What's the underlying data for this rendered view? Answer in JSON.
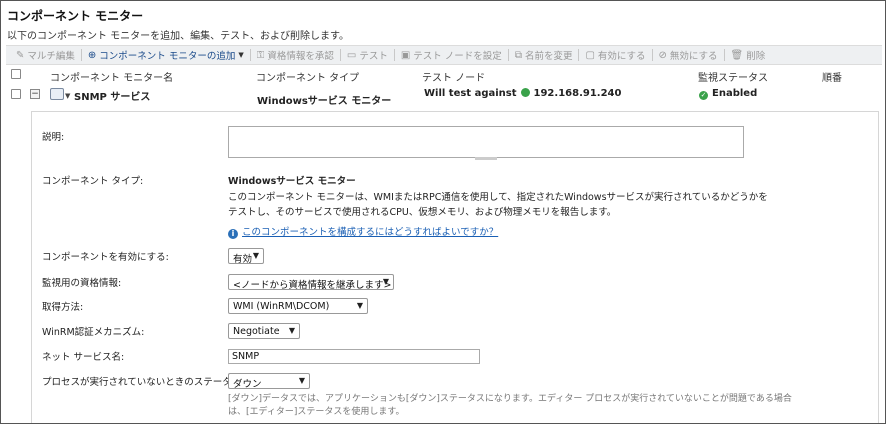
{
  "header": {
    "title": "コンポーネント モニター",
    "subtitle": "以下のコンポーネント モニターを追加、編集、テスト、および削除します。"
  },
  "toolbar": {
    "multi_edit": "マルチ編集",
    "add_monitor": "コンポーネント モニターの追加",
    "approve_credentials": "資格情報を承認",
    "test": "テスト",
    "set_test_node": "テスト ノードを設定",
    "rename": "名前を変更",
    "enable": "有効にする",
    "disable": "無効にする",
    "delete": "削除"
  },
  "columns": {
    "name": "コンポーネント モニター名",
    "type": "コンポーネント タイプ",
    "test_node": "テスト ノード",
    "status": "監視ステータス",
    "order": "順番"
  },
  "monitor_row": {
    "name": "SNMP サービス",
    "type": "Windowsサービス モニター",
    "test_node_prefix": "Will test against",
    "test_node_ip": "192.168.91.240",
    "status": "Enabled"
  },
  "details": {
    "description_label": "説明:",
    "description_value": "",
    "component_type_label": "コンポーネント タイプ:",
    "component_type_value": "Windowsサービス モニター",
    "component_desc_line1": "このコンポーネント モニターは、WMIまたはRPC通信を使用して、指定されたWindowsサービスが実行されているかどうかを",
    "component_desc_line2": "テストし、そのサービスで使用されるCPU、仮想メモリ、および物理メモリを報告します。",
    "help_link": "このコンポーネントを構成するにはどうすればよいですか？",
    "enable_label": "コンポーネントを有効にする:",
    "enable_value": "有効",
    "credential_label": "監視用の資格情報:",
    "credential_value": "<ノードから資格情報を継承します>",
    "fetch_method_label": "取得方法:",
    "fetch_method_value": "WMI (WinRM\\DCOM)",
    "winrm_auth_label": "WinRM認証メカニズム:",
    "winrm_auth_value": "Negotiate",
    "net_service_label": "ネット サービス名:",
    "net_service_value": "SNMP",
    "process_status_label": "プロセスが実行されていないときのステータス:",
    "process_status_value": "ダウン",
    "process_note_line1": "[ダウン]データスでは、アプリケーションも[ダウン]ステータスになります。エディター プロセスが実行されていないことが問題である場合",
    "process_note_line2": "は、[エディター]ステータスを使用します。"
  },
  "colors": {
    "status_green": "#3aa24a",
    "link_blue": "#1a5fb4",
    "toolbar_bg": "#eef0f2"
  }
}
